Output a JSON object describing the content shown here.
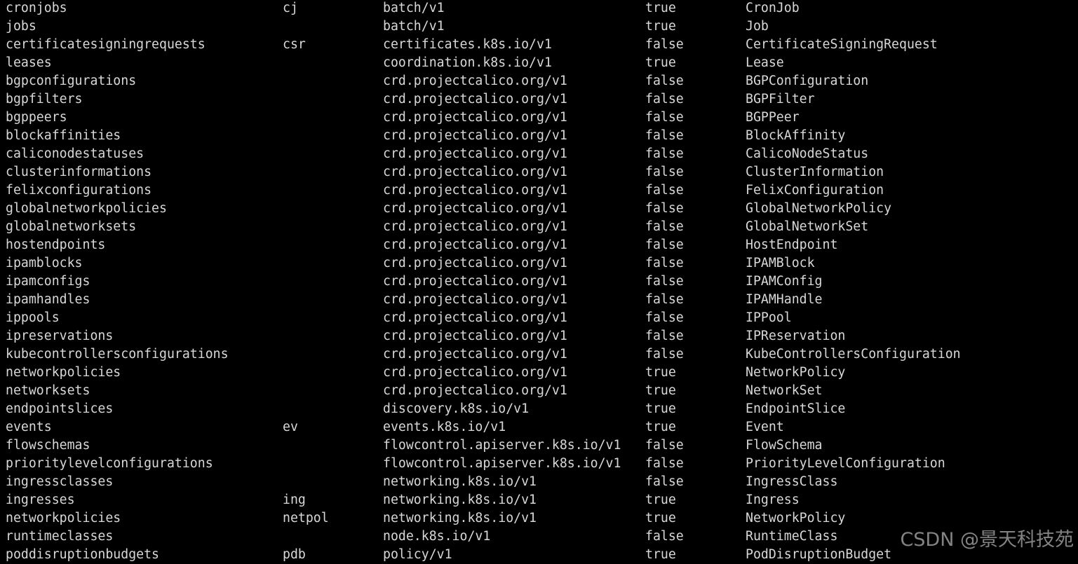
{
  "rows": [
    [
      "cronjobs",
      "cj",
      "batch/v1",
      "true",
      "CronJob"
    ],
    [
      "jobs",
      "",
      "batch/v1",
      "true",
      "Job"
    ],
    [
      "certificatesigningrequests",
      "csr",
      "certificates.k8s.io/v1",
      "false",
      "CertificateSigningRequest"
    ],
    [
      "leases",
      "",
      "coordination.k8s.io/v1",
      "true",
      "Lease"
    ],
    [
      "bgpconfigurations",
      "",
      "crd.projectcalico.org/v1",
      "false",
      "BGPConfiguration"
    ],
    [
      "bgpfilters",
      "",
      "crd.projectcalico.org/v1",
      "false",
      "BGPFilter"
    ],
    [
      "bgppeers",
      "",
      "crd.projectcalico.org/v1",
      "false",
      "BGPPeer"
    ],
    [
      "blockaffinities",
      "",
      "crd.projectcalico.org/v1",
      "false",
      "BlockAffinity"
    ],
    [
      "caliconodestatuses",
      "",
      "crd.projectcalico.org/v1",
      "false",
      "CalicoNodeStatus"
    ],
    [
      "clusterinformations",
      "",
      "crd.projectcalico.org/v1",
      "false",
      "ClusterInformation"
    ],
    [
      "felixconfigurations",
      "",
      "crd.projectcalico.org/v1",
      "false",
      "FelixConfiguration"
    ],
    [
      "globalnetworkpolicies",
      "",
      "crd.projectcalico.org/v1",
      "false",
      "GlobalNetworkPolicy"
    ],
    [
      "globalnetworksets",
      "",
      "crd.projectcalico.org/v1",
      "false",
      "GlobalNetworkSet"
    ],
    [
      "hostendpoints",
      "",
      "crd.projectcalico.org/v1",
      "false",
      "HostEndpoint"
    ],
    [
      "ipamblocks",
      "",
      "crd.projectcalico.org/v1",
      "false",
      "IPAMBlock"
    ],
    [
      "ipamconfigs",
      "",
      "crd.projectcalico.org/v1",
      "false",
      "IPAMConfig"
    ],
    [
      "ipamhandles",
      "",
      "crd.projectcalico.org/v1",
      "false",
      "IPAMHandle"
    ],
    [
      "ippools",
      "",
      "crd.projectcalico.org/v1",
      "false",
      "IPPool"
    ],
    [
      "ipreservations",
      "",
      "crd.projectcalico.org/v1",
      "false",
      "IPReservation"
    ],
    [
      "kubecontrollersconfigurations",
      "",
      "crd.projectcalico.org/v1",
      "false",
      "KubeControllersConfiguration"
    ],
    [
      "networkpolicies",
      "",
      "crd.projectcalico.org/v1",
      "true",
      "NetworkPolicy"
    ],
    [
      "networksets",
      "",
      "crd.projectcalico.org/v1",
      "true",
      "NetworkSet"
    ],
    [
      "endpointslices",
      "",
      "discovery.k8s.io/v1",
      "true",
      "EndpointSlice"
    ],
    [
      "events",
      "ev",
      "events.k8s.io/v1",
      "true",
      "Event"
    ],
    [
      "flowschemas",
      "",
      "flowcontrol.apiserver.k8s.io/v1",
      "false",
      "FlowSchema"
    ],
    [
      "prioritylevelconfigurations",
      "",
      "flowcontrol.apiserver.k8s.io/v1",
      "false",
      "PriorityLevelConfiguration"
    ],
    [
      "ingressclasses",
      "",
      "networking.k8s.io/v1",
      "false",
      "IngressClass"
    ],
    [
      "ingresses",
      "ing",
      "networking.k8s.io/v1",
      "true",
      "Ingress"
    ],
    [
      "networkpolicies",
      "netpol",
      "networking.k8s.io/v1",
      "true",
      "NetworkPolicy"
    ],
    [
      "runtimeclasses",
      "",
      "node.k8s.io/v1",
      "false",
      "RuntimeClass"
    ],
    [
      "poddisruptionbudgets",
      "pdb",
      "policy/v1",
      "true",
      "PodDisruptionBudget"
    ]
  ],
  "watermark": "CSDN @景天科技苑",
  "colors": {
    "background": "#000000",
    "text": "#d8d8d8"
  }
}
